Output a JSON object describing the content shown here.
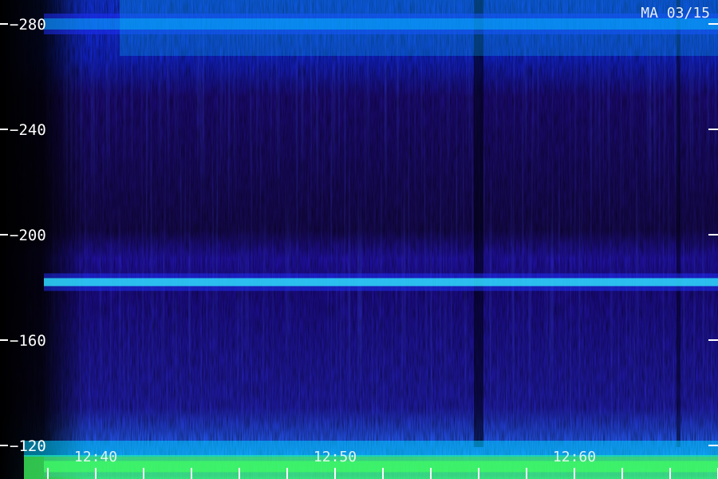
{
  "chart_data": {
    "type": "heatmap",
    "title": "MA 03/15",
    "y_ticks": [
      120,
      160,
      200,
      240,
      280
    ],
    "y_tick_labels": [
      "−120",
      "−160",
      "−200",
      "−240",
      "−280"
    ],
    "ylim": [
      100,
      290
    ],
    "x_ticks": [
      "12:40",
      "12:50",
      "12:60"
    ],
    "x_tick_values": [
      2,
      12,
      22
    ],
    "xlim": [
      -2,
      28
    ],
    "minor_x_ticks": [
      0,
      2,
      4,
      6,
      8,
      10,
      12,
      14,
      16,
      18,
      20,
      22,
      24,
      26,
      28
    ],
    "bands": [
      {
        "y": 182,
        "level": 0.95,
        "description": "strong horizontal band"
      },
      {
        "y": 280,
        "level": 0.55
      },
      {
        "y": 112,
        "level": 0.85
      }
    ],
    "colors": {
      "background": "#000000",
      "low": "#1a0066",
      "mid": "#2030ff",
      "high": "#00ccff",
      "peak": "#40ff60",
      "text": "#ffffff"
    },
    "grid": false
  }
}
